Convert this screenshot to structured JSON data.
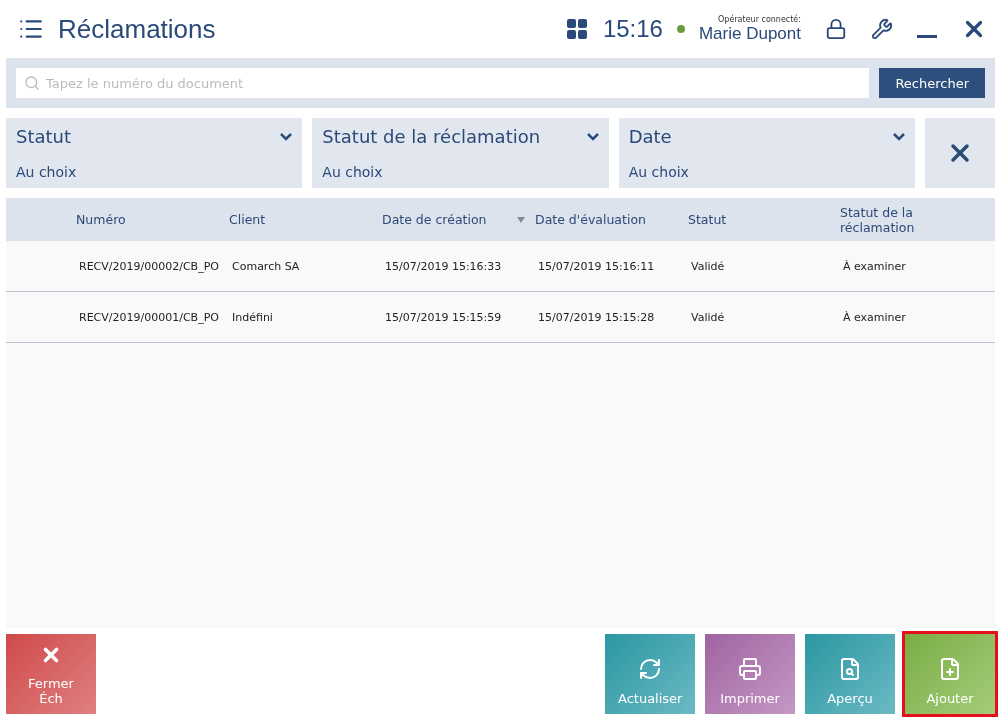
{
  "header": {
    "title": "Réclamations",
    "time": "15:16",
    "operator_label": "Opérateur connecté:",
    "operator_name": "Marie Dupont",
    "online": true
  },
  "search": {
    "placeholder": "Tapez le numéro du document",
    "button": "Rechercher"
  },
  "filters": [
    {
      "label": "Statut",
      "value": "Au choix"
    },
    {
      "label": "Statut de la réclamation",
      "value": "Au choix"
    },
    {
      "label": "Date",
      "value": "Au choix"
    }
  ],
  "table": {
    "columns": [
      {
        "label": "Numéro",
        "sorted": false
      },
      {
        "label": "Client",
        "sorted": false
      },
      {
        "label": "Date de création",
        "sorted": true
      },
      {
        "label": "Date d'évaluation",
        "sorted": false
      },
      {
        "label": "Statut",
        "sorted": false
      },
      {
        "label": "Statut de la réclamation",
        "sorted": false
      }
    ],
    "rows": [
      [
        "RECV/2019/00002/CB_PO",
        "Comarch SA",
        "15/07/2019 15:16:33",
        "15/07/2019 15:16:11",
        "Validé",
        "À examiner"
      ],
      [
        "RECV/2019/00001/CB_PO",
        "Indéfini",
        "15/07/2019 15:15:59",
        "15/07/2019 15:15:28",
        "Validé",
        "À examiner"
      ]
    ]
  },
  "actions": [
    {
      "kind": "close",
      "label": "Fermer Éch",
      "focused": false
    },
    {
      "kind": "refresh",
      "label": "Actualiser",
      "focused": false
    },
    {
      "kind": "print",
      "label": "Imprimer",
      "focused": false
    },
    {
      "kind": "preview",
      "label": "Aperçu",
      "focused": false
    },
    {
      "kind": "add",
      "label": "Ajouter",
      "focused": true
    }
  ]
}
